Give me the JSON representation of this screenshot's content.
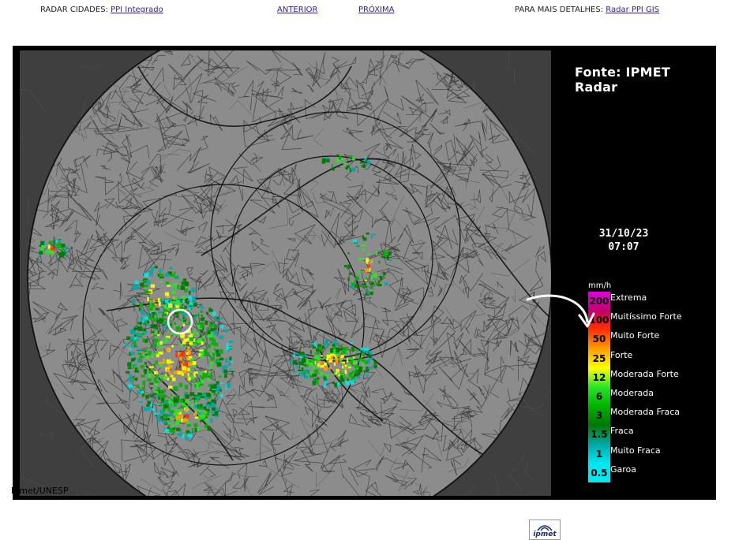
{
  "nav": {
    "cities_label": "RADAR CIDADES:",
    "cities_link": "PPI Integrado",
    "prev_link": "ANTERIOR",
    "next_link": "PRÓXIMA",
    "details_label": "PARA MAIS DETALHES:",
    "details_link": "Radar PPI GIS"
  },
  "panel": {
    "source": "Fonte: IPMET Radar",
    "date": "31/10/23",
    "time": "07:07",
    "unit": "mm/h",
    "credit": "Ipmet/UNESP",
    "logo_text": "ipmet"
  },
  "scale": [
    {
      "value": "200",
      "color": "#e000e0"
    },
    {
      "value": "100",
      "color": "#c0006e"
    },
    {
      "value": "50",
      "color": "#ff3000"
    },
    {
      "value": "25",
      "color": "#ffa000"
    },
    {
      "value": "12",
      "color": "#ffff00"
    },
    {
      "value": "6",
      "color": "#28e628"
    },
    {
      "value": "3",
      "color": "#00b400"
    },
    {
      "value": "1.5",
      "color": "#007800"
    },
    {
      "value": "1",
      "color": "#00a8a8"
    },
    {
      "value": "0.5",
      "color": "#00e8f0"
    }
  ],
  "categories": [
    "Extrema",
    "Muitíssimo Forte",
    "Muito Forte",
    "Forte",
    "Moderada Forte",
    "Moderada",
    "Moderada Fraca",
    "Fraca",
    "Muito Fraca",
    "Garoa"
  ]
}
